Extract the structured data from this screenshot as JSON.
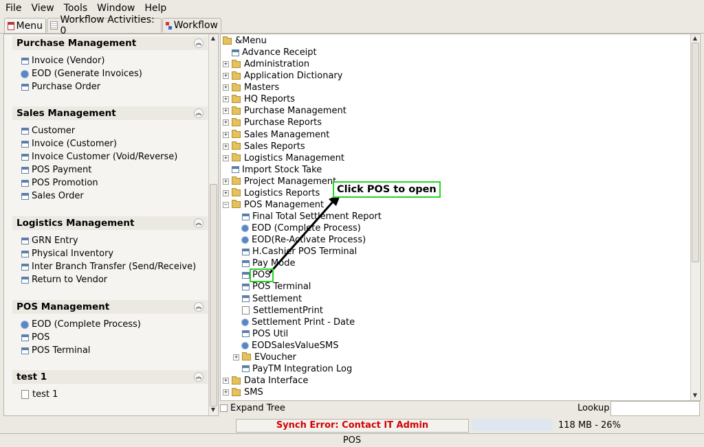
{
  "menubar": {
    "file": "File",
    "view": "View",
    "tools": "Tools",
    "window": "Window",
    "help": "Help"
  },
  "tabs": [
    {
      "label": "Menu",
      "icon": "home-icon"
    },
    {
      "label": "Workflow Activities: 0",
      "icon": "table-icon"
    },
    {
      "label": "Workflow",
      "icon": "workflow-icon"
    }
  ],
  "left_groups": [
    {
      "title": "Purchase Management",
      "items": [
        {
          "label": "Invoice (Vendor)",
          "icon": "window-icon"
        },
        {
          "label": "EOD (Generate Invoices)",
          "icon": "process-icon"
        },
        {
          "label": "Purchase Order",
          "icon": "window-icon"
        }
      ]
    },
    {
      "title": "Sales Management",
      "items": [
        {
          "label": "Customer",
          "icon": "window-icon"
        },
        {
          "label": "Invoice (Customer)",
          "icon": "window-icon"
        },
        {
          "label": "Invoice Customer (Void/Reverse)",
          "icon": "window-icon"
        },
        {
          "label": "POS Payment",
          "icon": "window-icon"
        },
        {
          "label": "POS Promotion",
          "icon": "window-icon"
        },
        {
          "label": "Sales Order",
          "icon": "window-icon"
        }
      ]
    },
    {
      "title": "Logistics Management",
      "items": [
        {
          "label": "GRN Entry",
          "icon": "window-icon"
        },
        {
          "label": "Physical Inventory",
          "icon": "window-icon"
        },
        {
          "label": "Inter Branch Transfer (Send/Receive)",
          "icon": "window-icon"
        },
        {
          "label": "Return to Vendor",
          "icon": "window-icon"
        }
      ]
    },
    {
      "title": "POS Management",
      "items": [
        {
          "label": "EOD (Complete Process)",
          "icon": "process-icon"
        },
        {
          "label": "POS",
          "icon": "window-icon"
        },
        {
          "label": "POS Terminal",
          "icon": "window-icon"
        }
      ]
    },
    {
      "title": "test 1",
      "items": [
        {
          "label": "test 1",
          "icon": "report-icon"
        }
      ]
    }
  ],
  "tree": [
    {
      "label": "&Menu",
      "type": "root"
    },
    {
      "label": "Advance Receipt",
      "type": "window"
    },
    {
      "label": "Administration",
      "type": "folder"
    },
    {
      "label": "Application Dictionary",
      "type": "folder"
    },
    {
      "label": "Masters",
      "type": "folder"
    },
    {
      "label": "HQ Reports",
      "type": "folder"
    },
    {
      "label": "Purchase Management",
      "type": "folder"
    },
    {
      "label": "Purchase Reports",
      "type": "folder"
    },
    {
      "label": "Sales Management",
      "type": "folder"
    },
    {
      "label": "Sales Reports",
      "type": "folder"
    },
    {
      "label": "Logistics Management",
      "type": "folder"
    },
    {
      "label": "Import Stock Take",
      "type": "window"
    },
    {
      "label": "Project Management",
      "type": "folder"
    },
    {
      "label": "Logistics Reports",
      "type": "folder"
    },
    {
      "label": "POS Management",
      "type": "folder-open"
    },
    {
      "label": "Final Total Settlement Report",
      "type": "window"
    },
    {
      "label": "EOD (Complete Process)",
      "type": "process"
    },
    {
      "label": "EOD(Re-Activate Process)",
      "type": "process"
    },
    {
      "label": "H.Cashier POS Terminal",
      "type": "window"
    },
    {
      "label": "Pay Mode",
      "type": "window"
    },
    {
      "label": "POS",
      "type": "window"
    },
    {
      "label": "POS Terminal",
      "type": "window"
    },
    {
      "label": "Settlement",
      "type": "window"
    },
    {
      "label": "SettlementPrint",
      "type": "report"
    },
    {
      "label": "Settlement Print - Date",
      "type": "process"
    },
    {
      "label": "POS Util",
      "type": "window"
    },
    {
      "label": "EODSalesValueSMS",
      "type": "process"
    },
    {
      "label": "EVoucher",
      "type": "folder"
    },
    {
      "label": "PayTM Integration Log",
      "type": "window"
    },
    {
      "label": "Data Interface",
      "type": "folder"
    },
    {
      "label": "SMS",
      "type": "folder"
    }
  ],
  "annotation": "Click POS to open",
  "bottom": {
    "expand_tree": "Expand Tree",
    "lookup": "Lookup"
  },
  "status": {
    "error": "Synch Error: Contact IT Admin",
    "memory": "118 MB - 26%",
    "current": "POS"
  },
  "colors": {
    "error": "#d20000",
    "highlight": "#23d623",
    "folder": "#e4c25d",
    "icon_blue": "#5a86c4"
  }
}
